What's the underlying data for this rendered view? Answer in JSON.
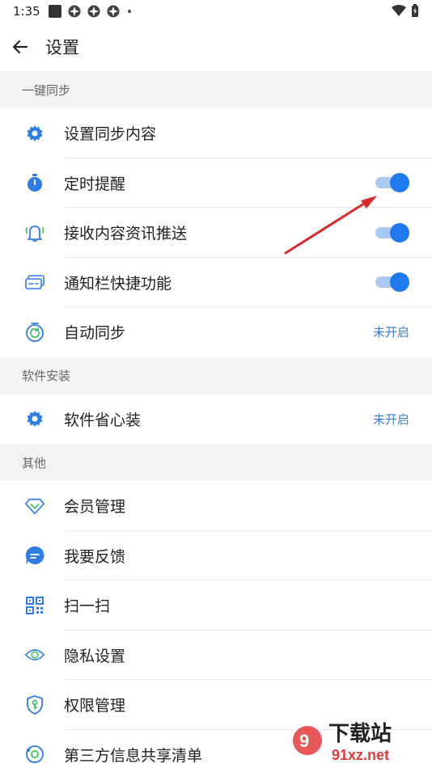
{
  "status_bar": {
    "time": "1:35"
  },
  "header": {
    "title": "设置"
  },
  "sections": [
    {
      "title": "一键同步",
      "items": [
        {
          "label": "设置同步内容",
          "icon": "gear-icon"
        },
        {
          "label": "定时提醒",
          "icon": "stopwatch-icon",
          "toggle": true
        },
        {
          "label": "接收内容资讯推送",
          "icon": "bell-icon",
          "toggle": true
        },
        {
          "label": "通知栏快捷功能",
          "icon": "card-icon",
          "toggle": true
        },
        {
          "label": "自动同步",
          "icon": "sync-icon",
          "status": "未开启"
        }
      ]
    },
    {
      "title": "软件安装",
      "items": [
        {
          "label": "软件省心装",
          "icon": "gear-icon",
          "status": "未开启"
        }
      ]
    },
    {
      "title": "其他",
      "items": [
        {
          "label": "会员管理",
          "icon": "diamond-icon"
        },
        {
          "label": "我要反馈",
          "icon": "chat-icon"
        },
        {
          "label": "扫一扫",
          "icon": "qr-icon"
        },
        {
          "label": "隐私设置",
          "icon": "eye-icon"
        },
        {
          "label": "权限管理",
          "icon": "shield-icon"
        },
        {
          "label": "第三方信息共享清单",
          "icon": "share-icon"
        }
      ]
    }
  ],
  "watermark": {
    "line1": "下载站",
    "line2": "91xz.net"
  },
  "colors": {
    "accent": "#1f7af0",
    "status": "#3a7bd5",
    "arrow": "#d92b2b"
  }
}
